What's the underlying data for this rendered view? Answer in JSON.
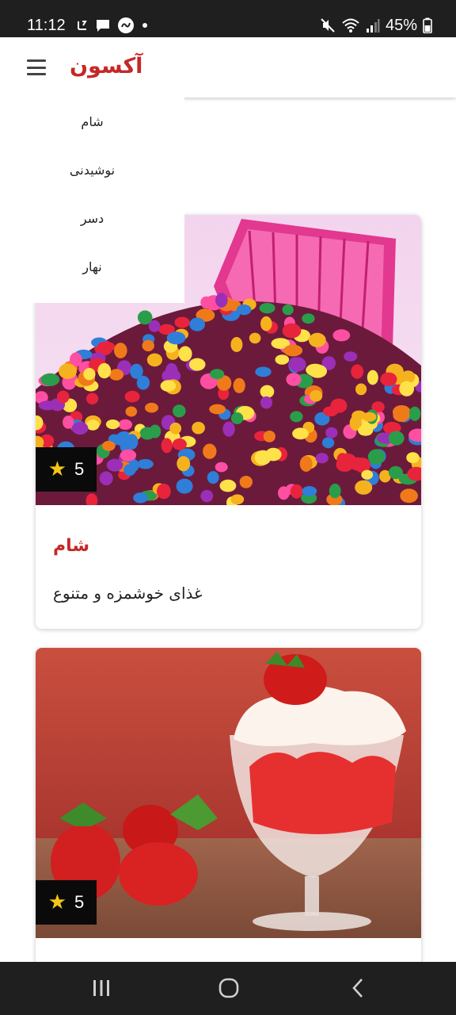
{
  "status_bar": {
    "time": "11:12",
    "battery": "45%",
    "left_icons": [
      "carrier-icon",
      "message-icon",
      "notification-badge-icon",
      "dot-icon"
    ],
    "right_icons": [
      "mute-icon",
      "wifi-icon",
      "signal-icon",
      "battery-icon"
    ]
  },
  "app_bar": {
    "brand": "آکسون",
    "menu_icon": "hamburger-icon"
  },
  "menu": {
    "items": [
      {
        "label": "شام"
      },
      {
        "label": "نوشیدنی"
      },
      {
        "label": "دسر"
      },
      {
        "label": "نهار"
      }
    ]
  },
  "cards": [
    {
      "rating": "5",
      "title": "شام",
      "description": "غذای خوشمزه و متنوع",
      "image": "colorful-candies-photo"
    },
    {
      "rating": "5",
      "image": "strawberry-dessert-photo"
    }
  ],
  "colors": {
    "accent": "#c62828",
    "star": "#f5c518",
    "system_bar": "#1f1f1f"
  },
  "nav_bar": {
    "icons": [
      "recent-apps-icon",
      "home-icon",
      "back-icon"
    ]
  }
}
